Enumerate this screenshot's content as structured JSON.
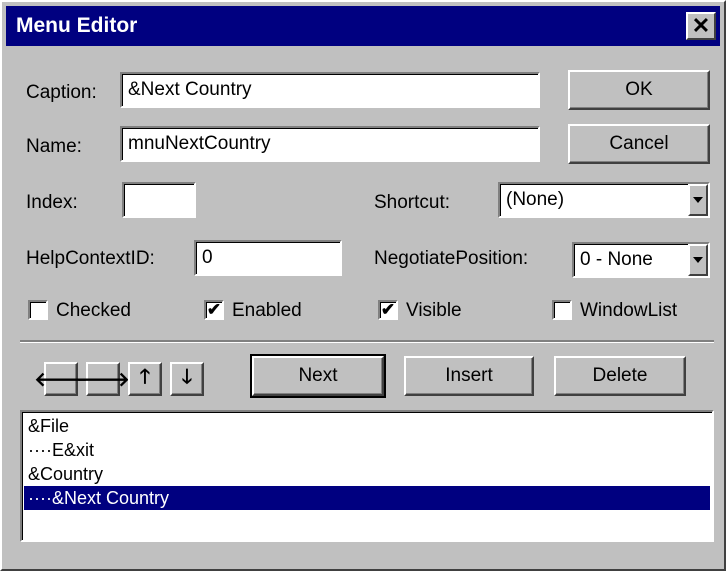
{
  "window": {
    "title": "Menu Editor"
  },
  "labels": {
    "caption": "Caption:",
    "name": "Name:",
    "index": "Index:",
    "shortcut": "Shortcut:",
    "help_context_id": "HelpContextID:",
    "negotiate_position": "NegotiatePosition:"
  },
  "fields": {
    "caption": "&Next Country",
    "name": "mnuNextCountry",
    "index": "",
    "help_context_id": "0"
  },
  "selects": {
    "shortcut": "(None)",
    "negotiate_position": "0 - None"
  },
  "checkboxes": [
    {
      "label": "Checked",
      "checked": false
    },
    {
      "label": "Enabled",
      "checked": true
    },
    {
      "label": "Visible",
      "checked": true
    },
    {
      "label": "WindowList",
      "checked": false
    }
  ],
  "buttons": {
    "ok": "OK",
    "cancel": "Cancel",
    "next": "Next",
    "insert": "Insert",
    "delete": "Delete"
  },
  "arrows": [
    "arrow-left-icon",
    "arrow-right-icon",
    "arrow-up-icon",
    "arrow-down-icon"
  ],
  "menu_items": [
    {
      "text": "&File",
      "selected": false
    },
    {
      "text": "····E&xit",
      "selected": false
    },
    {
      "text": "&Country",
      "selected": false
    },
    {
      "text": "····&Next Country",
      "selected": true
    }
  ],
  "colors": {
    "titlebar": "#000080",
    "selection": "#000080",
    "face": "#c0c0c0"
  }
}
